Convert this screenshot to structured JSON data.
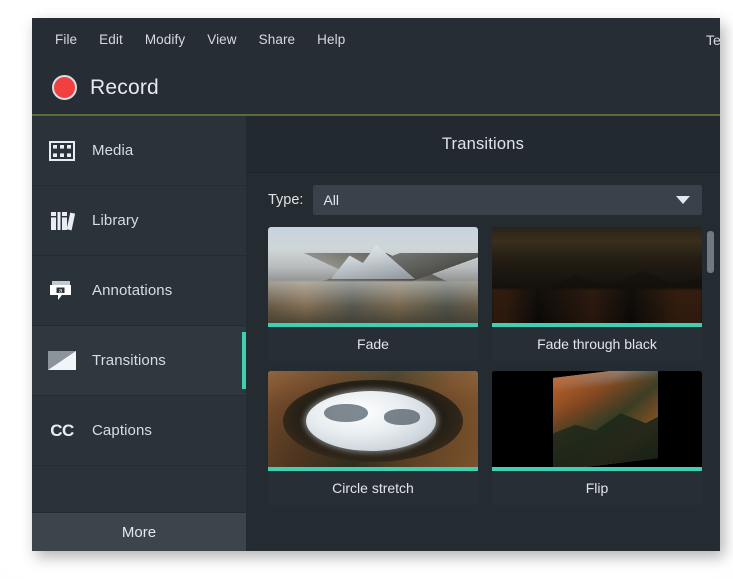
{
  "window": {
    "title_clipped": "TechSmith Camtasia"
  },
  "menubar": {
    "items": [
      {
        "label": "File"
      },
      {
        "label": "Edit"
      },
      {
        "label": "Modify"
      },
      {
        "label": "View"
      },
      {
        "label": "Share"
      },
      {
        "label": "Help"
      }
    ]
  },
  "toolbar": {
    "record_label": "Record",
    "record_dot_color": "#f0403f"
  },
  "sidebar": {
    "items": [
      {
        "label": "Media",
        "icon": "film-strip-icon",
        "active": false
      },
      {
        "label": "Library",
        "icon": "books-icon",
        "active": false
      },
      {
        "label": "Annotations",
        "icon": "speech-bubble-icon",
        "active": false
      },
      {
        "label": "Transitions",
        "icon": "transition-icon",
        "active": true
      },
      {
        "label": "Captions",
        "icon": "cc-icon",
        "active": false
      }
    ],
    "more_label": "More",
    "active_accent_color": "#3fcfb2"
  },
  "panel": {
    "title": "Transitions",
    "filter": {
      "label": "Type:",
      "value": "All",
      "options": [
        "All"
      ]
    },
    "transitions": [
      {
        "name": "Fade",
        "art": "art-fade"
      },
      {
        "name": "Fade through black",
        "art": "art-black"
      },
      {
        "name": "Circle stretch",
        "art": "art-circle"
      },
      {
        "name": "Flip",
        "art": "art-flip"
      }
    ],
    "thumb_accent_color": "#3fcfb2"
  }
}
